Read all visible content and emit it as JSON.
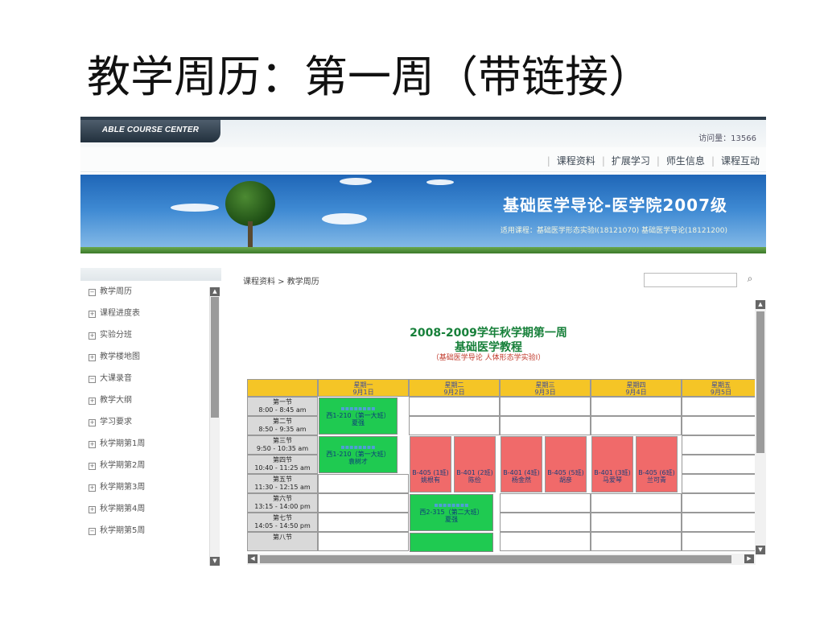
{
  "slide": {
    "title": "教学周历：第一周（带链接）"
  },
  "header": {
    "brand": "ABLE COURSE CENTER",
    "visits_label": "访问量：13566",
    "nav": [
      "课程资料",
      "扩展学习",
      "师生信息",
      "课程互动"
    ]
  },
  "banner": {
    "title": "基础医学导论-医学院2007级",
    "subtitle": "适用课程：基础医学形态实验Ⅰ(18121070) 基础医学导论(18121200)"
  },
  "sidebar": {
    "items": [
      "教学周历",
      "课程进度表",
      "实验分班",
      "教学楼地图",
      "大课录音",
      "教学大纲",
      "学习要求",
      "秋学期第1周",
      "秋学期第2周",
      "秋学期第3周",
      "秋学期第4周",
      "秋学期第5周"
    ]
  },
  "content": {
    "breadcrumb": "课程资料 > 教学周历",
    "search_placeholder": ""
  },
  "calendar": {
    "title": "2008-2009学年秋学期第一周",
    "course": "基础医学教程",
    "note": "（基础医学导论 人体形态学实验Ⅰ）",
    "days": [
      {
        "name": "星期一",
        "date": "9月1日"
      },
      {
        "name": "星期二",
        "date": "9月2日"
      },
      {
        "name": "星期三",
        "date": "9月3日"
      },
      {
        "name": "星期四",
        "date": "9月4日"
      },
      {
        "name": "星期五",
        "date": "9月5日"
      }
    ],
    "periods": [
      {
        "name": "第一节",
        "time": "8:00 - 8:45 am"
      },
      {
        "name": "第二节",
        "time": "8:50 - 9:35 am"
      },
      {
        "name": "第三节",
        "time": "9:50 - 10:35 am"
      },
      {
        "name": "第四节",
        "time": "10:40 - 11:25 am"
      },
      {
        "name": "第五节",
        "time": "11:30 - 12:15 am"
      },
      {
        "name": "第六节",
        "time": "13:15 - 14:00 pm"
      },
      {
        "name": "第七节",
        "time": "14:05 - 14:50 pm"
      },
      {
        "name": "第八节",
        "time": ""
      }
    ],
    "green_blocks": [
      {
        "room": "西1-210（第一大班）",
        "teacher": "夏强"
      },
      {
        "room": "西1-210（第一大班）",
        "teacher": "袁树才"
      },
      {
        "room": "西2-315（第二大班）",
        "teacher": "夏强"
      }
    ],
    "red_blocks": [
      {
        "room": "B-405 (1班)",
        "teacher": "姚根有"
      },
      {
        "room": "B-401 (2班)",
        "teacher": "陈俭"
      },
      {
        "room": "B-401 (4班)",
        "teacher": "杨金然"
      },
      {
        "room": "B-405 (5班)",
        "teacher": "胡彦"
      },
      {
        "room": "B-401 (3班)",
        "teacher": "马爱琴"
      },
      {
        "room": "B-405 (6班)",
        "teacher": "兰可青"
      }
    ]
  },
  "colors": {
    "header_yellow": "#f5c526",
    "block_green": "#1fca51",
    "block_red": "#f06a6a",
    "title_green": "#17803a",
    "banner_blue": "#1f66b7"
  }
}
